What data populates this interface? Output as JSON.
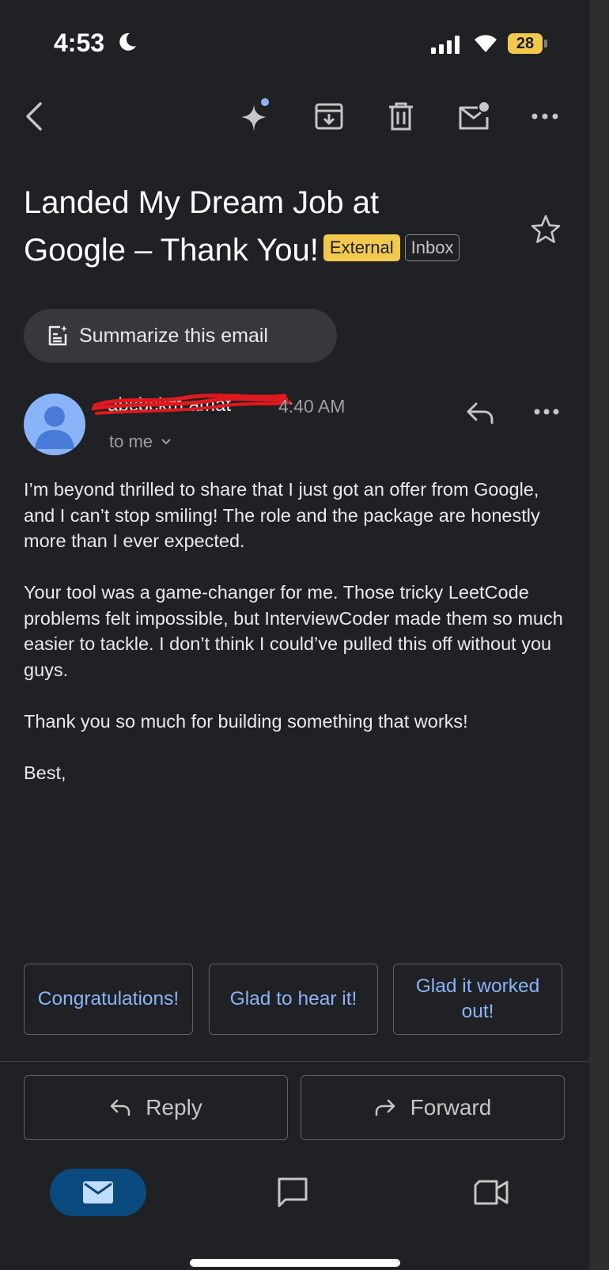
{
  "status_bar": {
    "time": "4:53",
    "battery": "28"
  },
  "toolbar": {
    "icons": [
      "back-icon",
      "sparkle-icon",
      "archive-icon",
      "delete-icon",
      "mark-unread-icon",
      "more-icon"
    ]
  },
  "email": {
    "subject_line1": "Landed My Dream Job at",
    "subject_line2": "Google – Thank You!",
    "label_external": "External",
    "label_inbox": "Inbox",
    "summarize_label": "Summarize this email",
    "sender_name": "abcbckm amat",
    "time": "4:40 AM",
    "recipient": "to me",
    "body": [
      "I’m beyond thrilled to share that I just got an offer from Google, and I can’t stop smiling! The role and the package are honestly more than I ever expected.",
      "Your tool was a game-changer for me. Those tricky LeetCode problems felt impossible, but InterviewCoder made them so much easier to tackle. I don’t think I could’ve pulled this off without you guys.",
      "Thank you so much for building something that works!",
      "Best,"
    ]
  },
  "smart_replies": [
    "Congratulations!",
    "Glad to hear it!",
    "Glad it worked out!"
  ],
  "actions": {
    "reply": "Reply",
    "forward": "Forward"
  },
  "bottom_nav": [
    "mail-icon",
    "chat-icon",
    "meet-icon"
  ],
  "colors": {
    "accent": "#8ab4f8",
    "external_badge": "#f2c94c",
    "background": "#202124",
    "nav_active": "#0b4a7e"
  }
}
